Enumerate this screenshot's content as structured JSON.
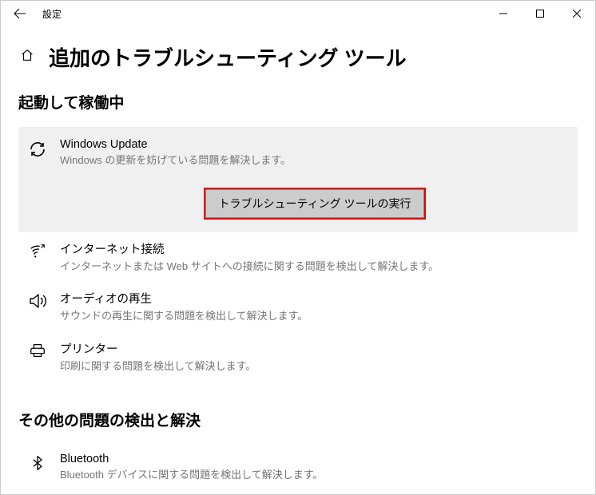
{
  "window": {
    "title": "設定"
  },
  "page": {
    "title": "追加のトラブルシューティング ツール"
  },
  "sections": {
    "running": {
      "title": "起動して稼働中",
      "items": [
        {
          "title": "Windows Update",
          "desc": "Windows の更新を妨げている問題を解決します。",
          "action": "トラブルシューティング ツールの実行"
        },
        {
          "title": "インターネット接続",
          "desc": "インターネットまたは Web サイトへの接続に関する問題を検出して解決します。"
        },
        {
          "title": "オーディオの再生",
          "desc": "サウンドの再生に関する問題を検出して解決します。"
        },
        {
          "title": "プリンター",
          "desc": "印刷に関する問題を検出して解決します。"
        }
      ]
    },
    "other": {
      "title": "その他の問題の検出と解決",
      "items": [
        {
          "title": "Bluetooth",
          "desc": "Bluetooth デバイスに関する問題を検出して解決します。"
        }
      ]
    }
  }
}
